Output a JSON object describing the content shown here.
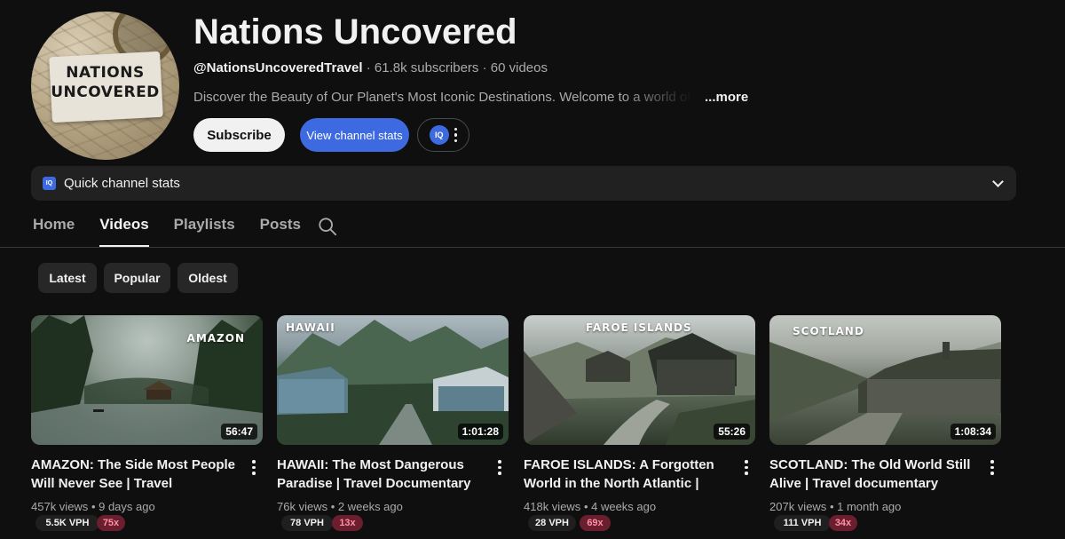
{
  "channel": {
    "name": "Nations Uncovered",
    "handle": "@NationsUncoveredTravel",
    "subscribers": "61.8k subscribers",
    "videos": "60 videos",
    "description": "Discover the Beauty of Our Planet's Most Iconic Destinations. Welcome to a world of",
    "more_label": "...more",
    "avatar_text": "NATIONS UNCOVERED"
  },
  "actions": {
    "subscribe_label": "Subscribe",
    "view_stats_label": "View channel stats",
    "iq_badge": "IQ"
  },
  "quick_stats": {
    "icon_text": "IQ",
    "label": "Quick channel stats"
  },
  "tabs": [
    {
      "label": "Home",
      "active": false
    },
    {
      "label": "Videos",
      "active": true
    },
    {
      "label": "Playlists",
      "active": false
    },
    {
      "label": "Posts",
      "active": false
    }
  ],
  "chips": [
    {
      "label": "Latest"
    },
    {
      "label": "Popular"
    },
    {
      "label": "Oldest"
    }
  ],
  "videos": [
    {
      "thumb_label": "AMAZON",
      "duration": "56:47",
      "title": "AMAZON: The Side Most People Will Never See | Travel Documentary",
      "views": "457k views",
      "age": "9 days ago",
      "vph": "5.5K VPH",
      "multiplier": "75x"
    },
    {
      "thumb_label": "HAWAII",
      "duration": "1:01:28",
      "title": "HAWAII: The Most Dangerous Paradise | Travel Documentary",
      "views": "76k views",
      "age": "2 weeks ago",
      "vph": "78 VPH",
      "multiplier": "13x"
    },
    {
      "thumb_label": "FAROE ISLANDS",
      "duration": "55:26",
      "title": "FAROE ISLANDS: A Forgotten World in the North Atlantic | Travel…",
      "views": "418k views",
      "age": "4 weeks ago",
      "vph": "28 VPH",
      "multiplier": "69x"
    },
    {
      "thumb_label": "SCOTLAND",
      "duration": "1:08:34",
      "title": "SCOTLAND: The Old World Still Alive | Travel documentary",
      "views": "207k views",
      "age": "1 month ago",
      "vph": "111 VPH",
      "multiplier": "34x"
    }
  ],
  "separator": "·",
  "colors": {
    "background": "#0f0f0f",
    "accent_blue": "#3e6ae1",
    "multiplier_bg": "#6b1f2e",
    "multiplier_text": "#ff8fa8"
  }
}
